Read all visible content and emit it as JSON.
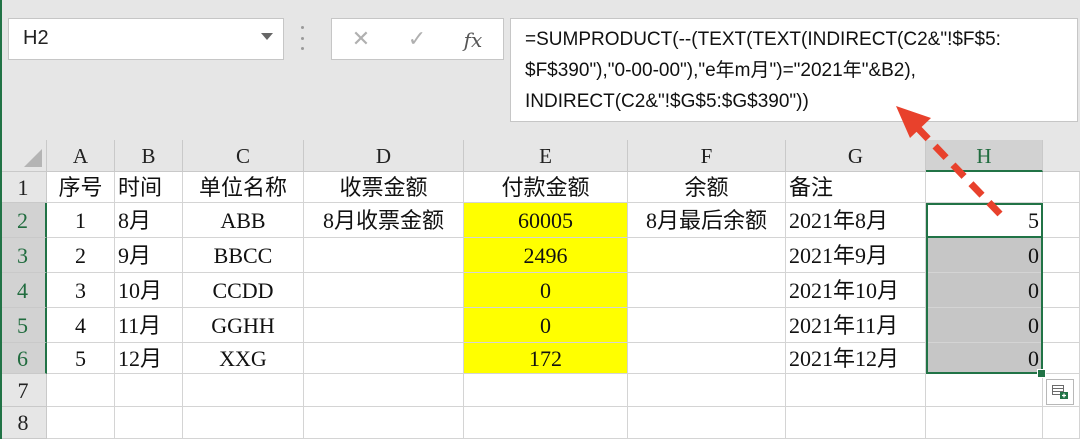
{
  "name_box": {
    "value": "H2"
  },
  "formula_bar": {
    "cancel_glyph": "✕",
    "enter_glyph": "✓",
    "fx_label": "fx",
    "lines": [
      "=SUMPRODUCT(--(TEXT(TEXT(INDIRECT(C2&\"!$F$5:",
      "$F$390\"),\"0-00-00\"),\"e年m月\")=\"2021年\"&B2),",
      "INDIRECT(C2&\"!$G$5:$G$390\"))"
    ]
  },
  "columns": [
    "A",
    "B",
    "C",
    "D",
    "E",
    "F",
    "G",
    "H"
  ],
  "rows": [
    "1",
    "2",
    "3",
    "4",
    "5",
    "6",
    "7",
    "8"
  ],
  "table": {
    "headers": [
      "序号",
      "时间",
      "单位名称",
      "收票金额",
      "付款金额",
      "余额",
      "备注",
      ""
    ],
    "data": [
      [
        "1",
        "8月",
        "ABB",
        "8月收票金额",
        "60005",
        "8月最后余额",
        "2021年8月",
        "5"
      ],
      [
        "2",
        "9月",
        "BBCC",
        "",
        "2496",
        "",
        "2021年9月",
        "0"
      ],
      [
        "3",
        "10月",
        "CCDD",
        "",
        "0",
        "",
        "2021年10月",
        "0"
      ],
      [
        "4",
        "11月",
        "GGHH",
        "",
        "0",
        "",
        "2021年11月",
        "0"
      ],
      [
        "5",
        "12月",
        "XXG",
        "",
        "172",
        "",
        "2021年12月",
        "0"
      ]
    ]
  },
  "colors": {
    "accent": "#217346",
    "highlight": "#ffff00",
    "annotation_arrow": "#e8412c"
  },
  "icons": {
    "quick_analysis": "quick-analysis-icon",
    "name_box_dropdown": "chevron-down-icon"
  }
}
